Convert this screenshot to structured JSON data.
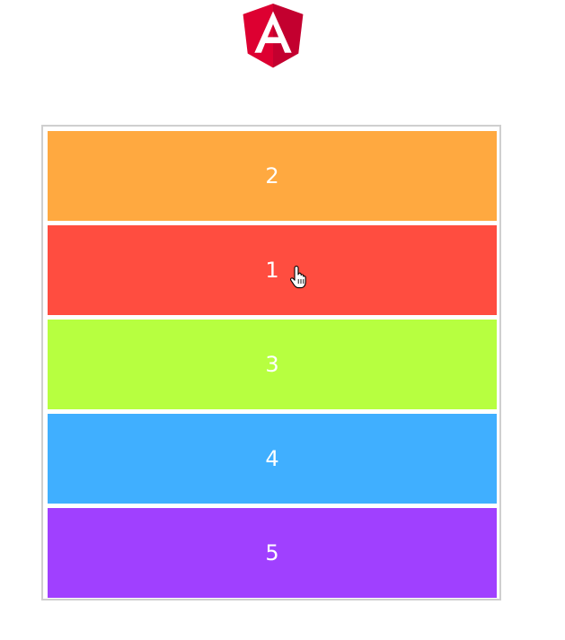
{
  "logo": {
    "icon": "angular-logo-icon",
    "letter": "A",
    "colors": {
      "shield_left": "#dd0031",
      "shield_right": "#c3002f",
      "letter": "#ffffff"
    }
  },
  "list": {
    "border_color": "#cfcfcf",
    "items": [
      {
        "label": "2",
        "color": "#ffa940"
      },
      {
        "label": "1",
        "color": "#ff4d40"
      },
      {
        "label": "3",
        "color": "#b7ff40"
      },
      {
        "label": "4",
        "color": "#40afff"
      },
      {
        "label": "5",
        "color": "#a040ff"
      }
    ]
  },
  "cursor": {
    "icon": "hand-pointer-icon"
  }
}
